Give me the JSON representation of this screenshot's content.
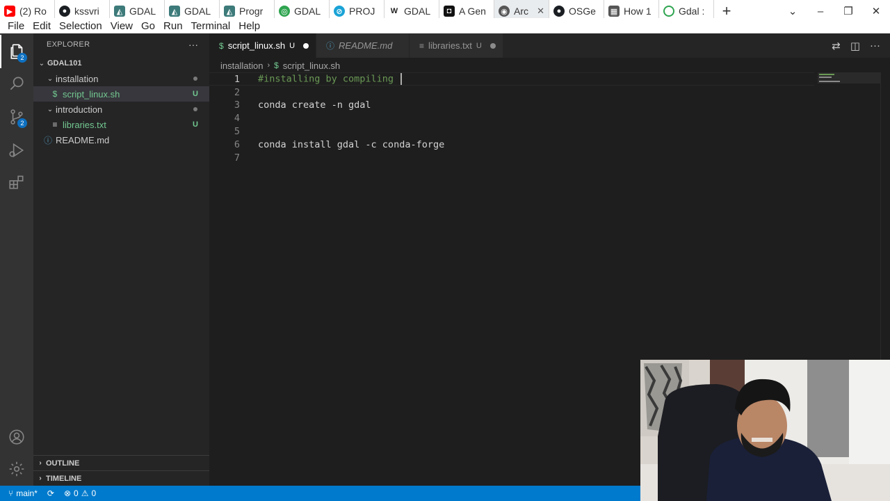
{
  "browser": {
    "tabs": [
      {
        "label": "(2) Ro",
        "icon": "youtube-icon",
        "color": "#ff0000"
      },
      {
        "label": "kssvri",
        "icon": "github-icon",
        "color": "#1b1f23"
      },
      {
        "label": "GDAL",
        "icon": "gdal-icon",
        "color": "#3d7a7a"
      },
      {
        "label": "GDAL",
        "icon": "gdal-icon",
        "color": "#3d7a7a"
      },
      {
        "label": "Progr",
        "icon": "progr-icon",
        "color": "#3d7a7a"
      },
      {
        "label": "GDAL",
        "icon": "gdal-green-icon",
        "color": "#2ea44f"
      },
      {
        "label": "PROJ",
        "icon": "proj-icon",
        "color": "#1aa3d6"
      },
      {
        "label": "GDAL",
        "icon": "wikipedia-icon",
        "color": "#222222"
      },
      {
        "label": "A Gen",
        "icon": "agen-icon",
        "color": "#111111"
      },
      {
        "label": "Arc",
        "icon": "globe-icon",
        "color": "#555555"
      },
      {
        "label": "OSGe",
        "icon": "github-icon",
        "color": "#1b1f23"
      },
      {
        "label": "How 1",
        "icon": "doc-icon",
        "color": "#555555"
      },
      {
        "label": "Gdal :",
        "icon": "loading-icon",
        "color": "#2ea44f"
      }
    ],
    "new_tab": "+",
    "controls": {
      "dropdown": "⌄",
      "minimize": "–",
      "restore": "❐",
      "close": "✕"
    }
  },
  "menubar": [
    "File",
    "Edit",
    "Selection",
    "View",
    "Go",
    "Run",
    "Terminal",
    "Help"
  ],
  "activity": {
    "explorer_badge": "2",
    "scm_badge": "2"
  },
  "sidebar": {
    "title": "EXPLORER",
    "more": "···",
    "workspace": "GDAL101",
    "tree": [
      {
        "label": "installation",
        "depth": 1,
        "type": "folder"
      },
      {
        "label": "script_linux.sh",
        "depth": 2,
        "type": "sh",
        "status": "U"
      },
      {
        "label": "introduction",
        "depth": 1,
        "type": "folder"
      },
      {
        "label": "libraries.txt",
        "depth": 2,
        "type": "txt",
        "status": "U"
      },
      {
        "label": "README.md",
        "depth": 1,
        "type": "md"
      }
    ],
    "outline": "OUTLINE",
    "timeline": "TIMELINE"
  },
  "editor": {
    "tabs": [
      {
        "label": "script_linux.sh",
        "status": "U",
        "active": true,
        "icon": "$"
      },
      {
        "label": "README.md",
        "active": false,
        "icon": "ⓘ"
      },
      {
        "label": "libraries.txt",
        "status": "U",
        "active": false,
        "icon": "≡"
      }
    ],
    "breadcrumb": {
      "folder": "installation",
      "file": "script_linux.sh",
      "icon": "$"
    },
    "lines": [
      {
        "n": "1",
        "text": "#installing by compiling ",
        "kind": "comment"
      },
      {
        "n": "2",
        "text": ""
      },
      {
        "n": "3",
        "text": "conda create -n gdal"
      },
      {
        "n": "4",
        "text": ""
      },
      {
        "n": "5",
        "text": ""
      },
      {
        "n": "6",
        "text": "conda install gdal -c conda-forge"
      },
      {
        "n": "7",
        "text": ""
      }
    ]
  },
  "statusbar": {
    "branch": "main*",
    "errors": "0",
    "warnings": "0"
  },
  "colors": {
    "accent": "#007acc",
    "untracked": "#73c991",
    "comment": "#6a9955"
  }
}
